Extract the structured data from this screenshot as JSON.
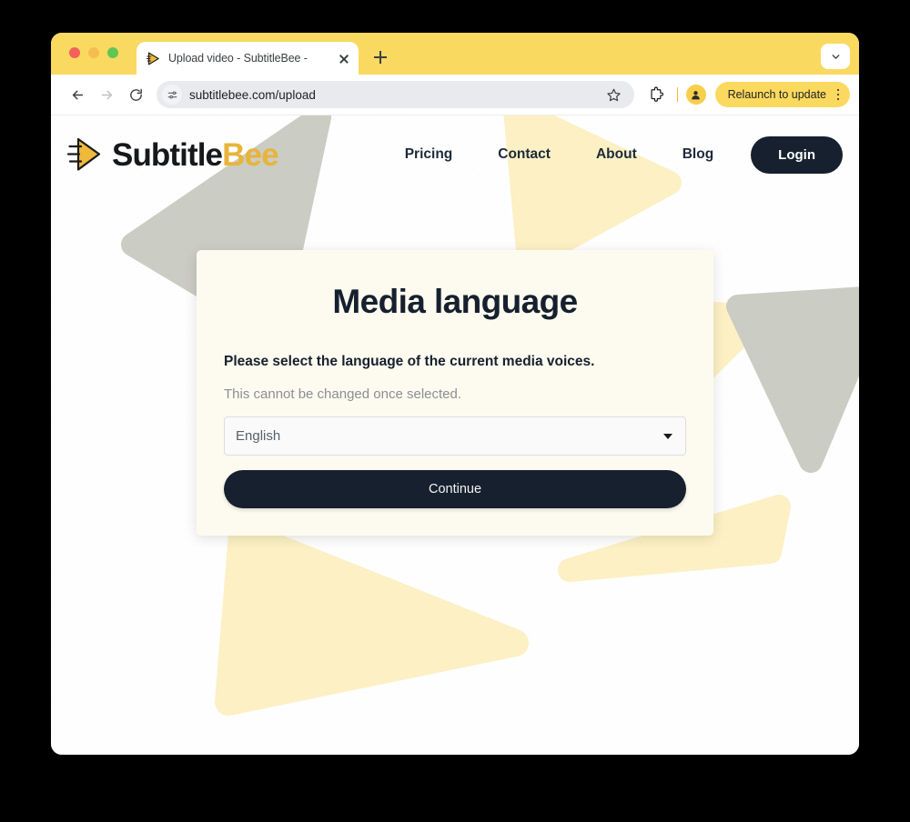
{
  "browser": {
    "tab": {
      "title": "Upload video - SubtitleBee - ",
      "favicon": "play-triangle-icon",
      "close": "close-icon"
    },
    "new_tab": "+",
    "tabstrip_menu_icon": "chevron-down-icon",
    "toolbar": {
      "back_icon": "back-arrow-icon",
      "forward_icon": "forward-arrow-icon",
      "reload_icon": "reload-icon",
      "site_info_icon": "tune-settings-icon",
      "url": "subtitlebee.com/upload",
      "star_icon": "star-icon",
      "extensions_icon": "puzzle-piece-icon",
      "profile_icon": "person-avatar-icon",
      "relaunch_label": "Relaunch to update",
      "menu_icon": "kebab-menu-icon"
    }
  },
  "site": {
    "logo": {
      "icon": "subtitlebee-play-logo-icon",
      "text_dark": "Subtitle",
      "text_accent": "Bee"
    },
    "nav": [
      {
        "label": "Pricing"
      },
      {
        "label": "Contact"
      },
      {
        "label": "About"
      },
      {
        "label": "Blog"
      }
    ],
    "login_label": "Login"
  },
  "modal": {
    "title": "Media language",
    "lead": "Please select the language of the current media voices.",
    "subtext": "This cannot be changed once selected.",
    "select": {
      "value": "English",
      "caret_icon": "caret-down-icon"
    },
    "continue_label": "Continue"
  },
  "colors": {
    "brand_yellow": "#E8B43A",
    "tabstrip_yellow": "#FAD961",
    "relaunch_yellow": "#FBD95F",
    "dark_navy": "#16202E",
    "card_cream": "#FDFBEF",
    "deco_gray": "#CBCCC3",
    "deco_yellow": "#FCF0C4",
    "page_bg": "#FEFEFE"
  }
}
